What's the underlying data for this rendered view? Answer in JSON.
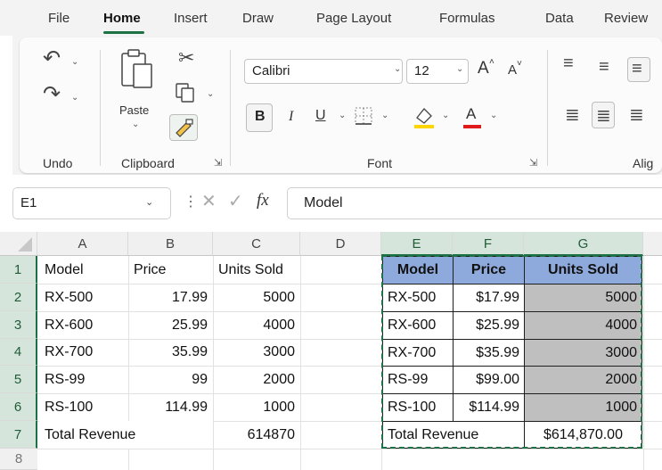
{
  "ribbon": {
    "tabs": [
      "File",
      "Home",
      "Insert",
      "Draw",
      "Page Layout",
      "Formulas",
      "Data",
      "Review"
    ],
    "active_tab": "Home",
    "groups": {
      "undo": "Undo",
      "clipboard": "Clipboard",
      "font": "Font",
      "alignment": "Alig"
    },
    "paste_label": "Paste",
    "font_name": "Calibri",
    "font_size": "12",
    "bold": "B",
    "italic": "I",
    "underline": "U",
    "grow_font": "A",
    "shrink_font": "A",
    "font_color": "A"
  },
  "formula_bar": {
    "name_box": "E1",
    "fx": "fx",
    "content": "Model"
  },
  "columns": [
    "A",
    "B",
    "C",
    "D",
    "E",
    "F",
    "G"
  ],
  "rows": [
    "1",
    "2",
    "3",
    "4",
    "5",
    "6",
    "7",
    "8"
  ],
  "left_table": {
    "headers": [
      "Model",
      "Price",
      "Units Sold"
    ],
    "rows": [
      [
        "RX-500",
        "17.99",
        "5000"
      ],
      [
        "RX-600",
        "25.99",
        "4000"
      ],
      [
        "RX-700",
        "35.99",
        "3000"
      ],
      [
        "RS-99",
        "99",
        "2000"
      ],
      [
        "RS-100",
        "114.99",
        "1000"
      ]
    ],
    "total_label": "Total Revenue",
    "total_value": "614870"
  },
  "right_table": {
    "headers": [
      "Model",
      "Price",
      "Units Sold"
    ],
    "rows": [
      [
        "RX-500",
        "$17.99",
        "5000"
      ],
      [
        "RX-600",
        "$25.99",
        "4000"
      ],
      [
        "RX-700",
        "$35.99",
        "3000"
      ],
      [
        "RS-99",
        "$99.00",
        "2000"
      ],
      [
        "RS-100",
        "$114.99",
        "1000"
      ]
    ],
    "total_label": "Total Revenue",
    "total_value": "$614,870.00"
  },
  "colors": {
    "accent": "#1e7145",
    "header_fill": "#8ea9db",
    "body_fill": "#bfbfbf"
  }
}
